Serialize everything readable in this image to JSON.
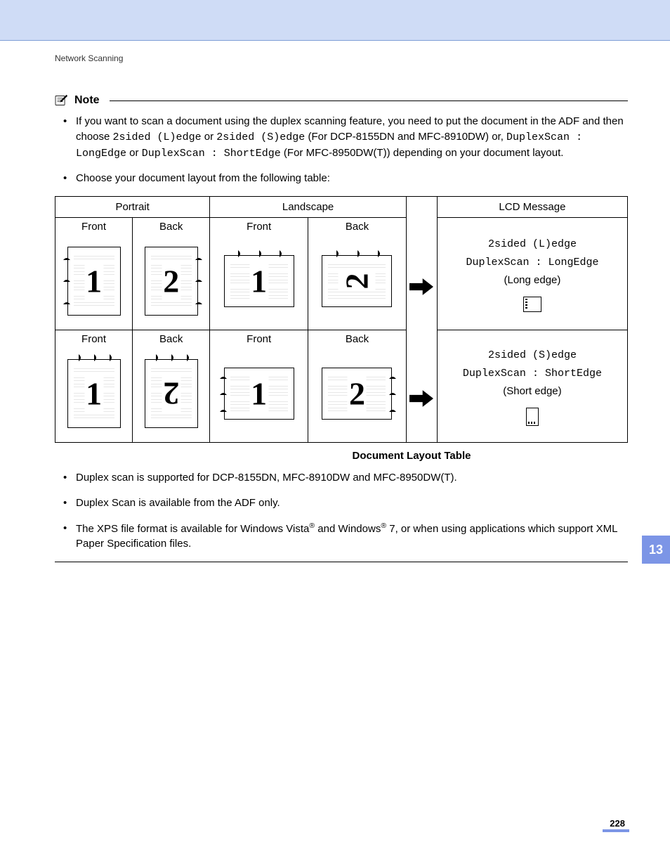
{
  "header": {
    "section": "Network Scanning"
  },
  "note": {
    "title": "Note",
    "bullets": [
      {
        "pre": "If you want to scan a document using the duplex scanning feature, you need to put the document in the ADF and then choose ",
        "mono1": "2sided (L)edge",
        "mid1": " or ",
        "mono2": "2sided (S)edge",
        "mid2": " (For DCP-8155DN and MFC-8910DW) or, ",
        "mono3": "DuplexScan : LongEdge",
        "mid3": " or ",
        "mono4": "DuplexScan : ShortEdge",
        "post": " (For MFC-8950DW(T)) depending on your document layout."
      },
      {
        "text": "Choose your document layout from the following table:"
      }
    ]
  },
  "table": {
    "headers": {
      "portrait": "Portrait",
      "landscape": "Landscape",
      "lcd": "LCD Message"
    },
    "front": "Front",
    "back": "Back",
    "rows": [
      {
        "portrait_front": "1",
        "portrait_back": "2",
        "landscape_front": "1",
        "landscape_back_rot": "rot270",
        "landscape_back": "2",
        "lcd_mono1": "2sided (L)edge",
        "lcd_mono2": "DuplexScan : LongEdge",
        "lcd_paren": "(Long edge)"
      },
      {
        "portrait_front": "1",
        "portrait_back_rot": "rot180",
        "portrait_back": "2",
        "landscape_front": "1",
        "landscape_back": "2",
        "lcd_mono1": "2sided (S)edge",
        "lcd_mono2": "DuplexScan : ShortEdge",
        "lcd_paren": "(Short edge)"
      }
    ],
    "caption": "Document Layout Table"
  },
  "bullets_after": [
    {
      "text": "Duplex scan is supported for DCP-8155DN, MFC-8910DW and MFC-8950DW(T)."
    },
    {
      "text": "Duplex Scan is available from the ADF only."
    },
    {
      "pre": "The XPS file format is available for Windows Vista",
      "sup1": "®",
      "mid": " and Windows",
      "sup2": "®",
      "post": " 7, or when using applications which support XML Paper Specification files."
    }
  ],
  "chapter_tab": "13",
  "page_number": "228"
}
